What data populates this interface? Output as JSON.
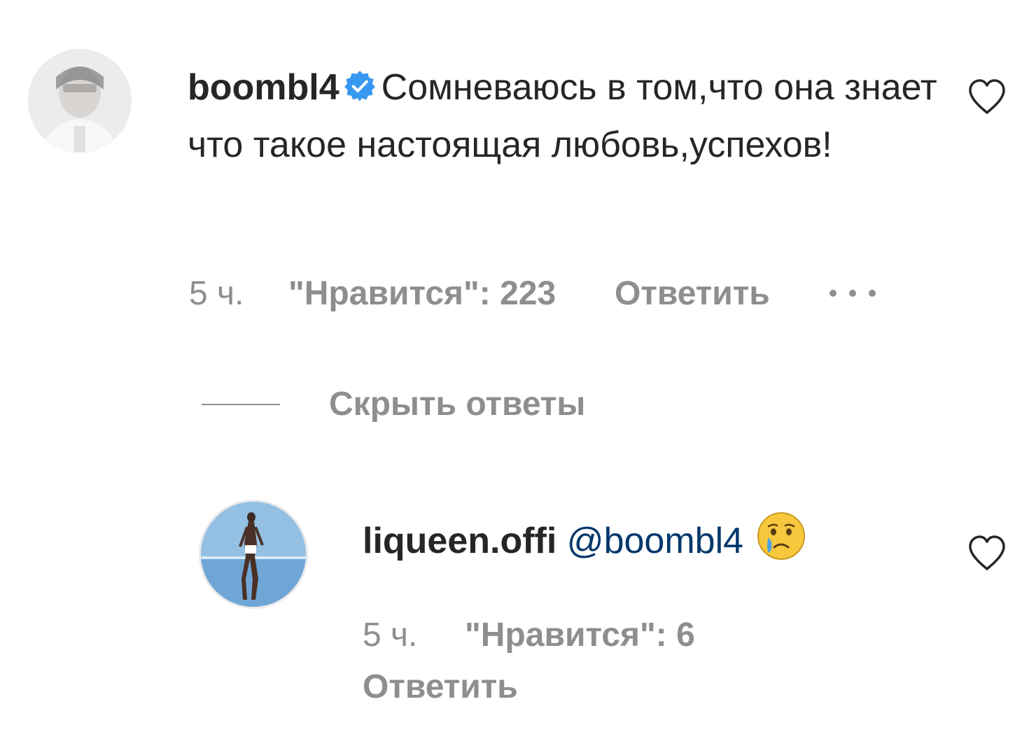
{
  "comment": {
    "username": "boombl4",
    "verified_icon": "verified-badge-icon",
    "text": "Сомневаюсь в том,что она знает что такое настоящая любовь,успехов!",
    "time": "5 ч.",
    "likes_label": "\"Нравится\": 223",
    "reply_label": "Ответить",
    "more_icon": "more-options-icon",
    "like_icon": "heart-icon"
  },
  "replies_toggle": {
    "label": "Скрыть ответы"
  },
  "reply": {
    "username": "liqueen.offi",
    "mention": "@boombl4",
    "emoji_icon": "crying-face-emoji",
    "time": "5 ч.",
    "likes_label": "\"Нравится\": 6",
    "reply_label": "Ответить",
    "like_icon": "heart-icon"
  },
  "colors": {
    "text_primary": "#262626",
    "text_secondary": "#8e8e8e",
    "verified_blue": "#3897f0",
    "mention": "#00376b"
  }
}
